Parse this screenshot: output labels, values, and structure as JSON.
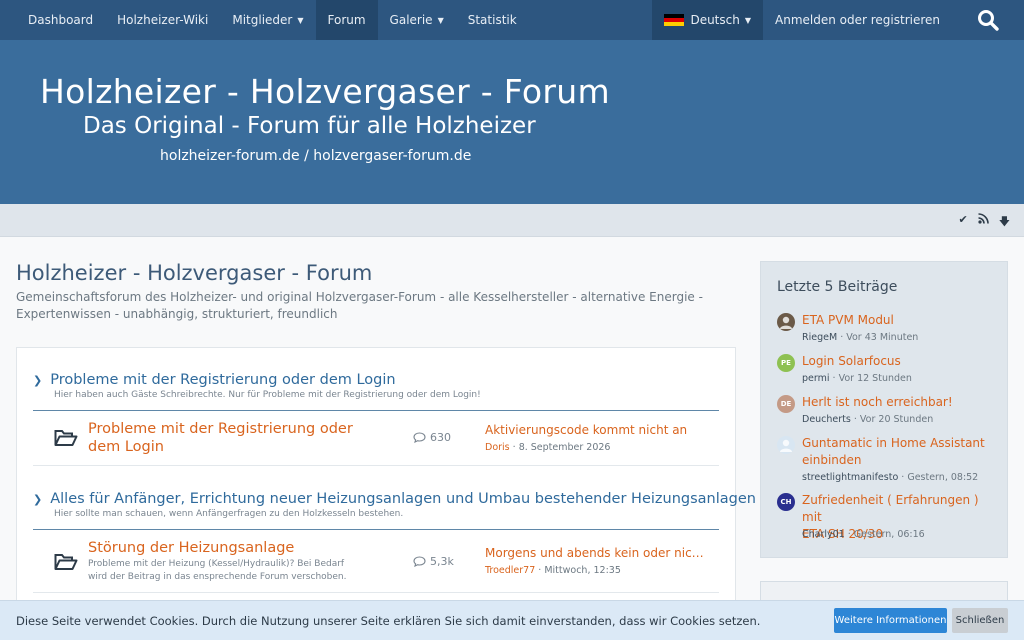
{
  "nav": {
    "items": [
      {
        "label": "Dashboard",
        "dropdown": false,
        "active": false
      },
      {
        "label": "Holzheizer-Wiki",
        "dropdown": false,
        "active": false
      },
      {
        "label": "Mitglieder",
        "dropdown": true,
        "active": false
      },
      {
        "label": "Forum",
        "dropdown": false,
        "active": true
      },
      {
        "label": "Galerie",
        "dropdown": true,
        "active": false
      },
      {
        "label": "Statistik",
        "dropdown": false,
        "active": false
      }
    ],
    "language": "Deutsch",
    "login": "Anmelden oder registrieren",
    "search_icon": "search-icon"
  },
  "header": {
    "line1": "Holzheizer - Holzvergaser - Forum",
    "line2": "Das Original - Forum für alle Holzheizer",
    "line3": "holzheizer-forum.de / holzvergaser-forum.de"
  },
  "subnav_icons": [
    "check-icon",
    "rss-icon",
    "arrow-down-icon"
  ],
  "page": {
    "title": "Holzheizer - Holzvergaser - Forum",
    "description": "Gemeinschaftsforum des Holzheizer- und original Holzvergaser-Forum - alle Kesselhersteller - alternative Energie - Expertenwissen - unabhängig, strukturiert, freundlich"
  },
  "categories": [
    {
      "title": "Probleme mit der Registrierung oder dem Login",
      "description": "Hier haben auch Gäste Schreibrechte. Nur für Probleme mit der Registrierung oder dem Login!",
      "board": {
        "title_line1": "Probleme mit der Registrierung oder",
        "title_line2": "dem Login",
        "desc_line1": "",
        "desc_line2": "",
        "count": "630",
        "last_title": "Aktivierungscode kommt nicht an",
        "last_user": "Doris",
        "last_time": "8. September 2026"
      }
    },
    {
      "title": "Alles für Anfänger, Errichtung neuer Heizungsanlagen und Umbau bestehender Heizungsanlagen",
      "description": "Hier sollte man schauen, wenn Anfängerfragen zu den Holzkesseln bestehen.",
      "board": {
        "title_line1": "Störung der Heizungsanlage",
        "title_line2": "",
        "desc_line1": "Probleme mit der Heizung (Kessel/Hydraulik)? Bei Bedarf",
        "desc_line2": "wird der Beitrag in das ensprechende Forum verschoben.",
        "count": "5,3k",
        "last_title": "Morgens und abends kein oder nicht …",
        "last_user": "Troedler77",
        "last_time": "Mittwoch, 12:35"
      }
    }
  ],
  "sidebar": {
    "title": "Letzte 5 Beiträge",
    "posts": [
      {
        "line1": "ETA PVM Modul",
        "line2": "",
        "user": "RiegeM",
        "time": "Vor 43 Minuten",
        "avatar": "",
        "color": "#6b5a48"
      },
      {
        "line1": "Login Solarfocus",
        "line2": "",
        "user": "permi",
        "time": "Vor 12 Stunden",
        "avatar": "PE",
        "color": "#8ec152"
      },
      {
        "line1": "Herlt ist noch erreichbar!",
        "line2": "",
        "user": "Deucherts",
        "time": "Vor 20 Stunden",
        "avatar": "DE",
        "color": "#c49a86"
      },
      {
        "line1": "Guntamatic in Home Assistant",
        "line2": "einbinden",
        "user": "streetlightmanifesto",
        "time": "Gestern, 08:52",
        "avatar": "",
        "color": "#d8e6f2"
      },
      {
        "line1": "Zufriedenheit ( Erfahrungen ) mit",
        "line2": "ETA SH 20/30",
        "user": "Charly01",
        "time": "Gestern, 06:16",
        "avatar": "CH",
        "color": "#2a2f8f"
      }
    ]
  },
  "cookie": {
    "text": "Diese Seite verwendet Cookies. Durch die Nutzung unserer Seite erklären Sie sich damit einverstanden, dass wir Cookies setzen.",
    "more": "Weitere Informationen",
    "close": "Schließen"
  },
  "colors": {
    "nav": "#2d5680",
    "header": "#3a6d9c",
    "link_orange": "#d9641e",
    "category_blue": "#2f6a9c",
    "button_blue": "#2d86d6"
  }
}
